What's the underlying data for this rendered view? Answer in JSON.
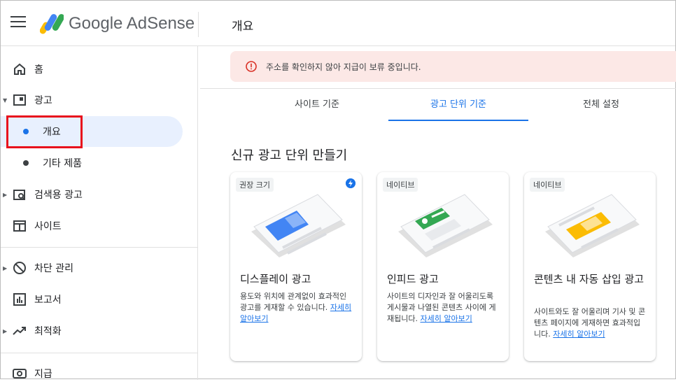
{
  "header": {
    "brand": "Google AdSense",
    "page_title": "개요"
  },
  "sidebar": {
    "items": [
      {
        "label": "홈",
        "icon": "home-icon"
      },
      {
        "label": "광고",
        "icon": "ads-icon"
      },
      {
        "label": "개요"
      },
      {
        "label": "기타 제품"
      },
      {
        "label": "검색용 광고",
        "icon": "search-ads-icon"
      },
      {
        "label": "사이트",
        "icon": "sites-icon"
      },
      {
        "label": "차단 관리",
        "icon": "block-icon"
      },
      {
        "label": "보고서",
        "icon": "reports-icon"
      },
      {
        "label": "최적화",
        "icon": "optimize-icon"
      },
      {
        "label": "지급",
        "icon": "payments-icon"
      }
    ]
  },
  "alert": {
    "text": "주소를 확인하지 않아 지급이 보류 중입니다."
  },
  "tabs": [
    {
      "label": "사이트 기준"
    },
    {
      "label": "광고 단위 기준",
      "active": true
    },
    {
      "label": "전체 설정"
    }
  ],
  "section_title": "신규 광고 단위 만들기",
  "cards": [
    {
      "chip": "권장 크기",
      "title": "디스플레이 광고",
      "desc": "용도와 위치에 관계없이 효과적인 광고를 게재할 수 있습니다.",
      "link": "자세히 알아보기"
    },
    {
      "chip": "네이티브",
      "title": "인피드 광고",
      "desc": "사이트의 디자인과 잘 어울리도록 게시물과 나열된 콘텐츠 사이에 게재됩니다.",
      "link": "자세히 알아보기"
    },
    {
      "chip": "네이티브",
      "title": "콘텐츠 내 자동 삽입 광고",
      "desc": "사이트와도 잘 어울리며 기사 및 콘텐츠 페이지에 게재하면 효과적입니다.",
      "link": "자세히 알아보기"
    }
  ],
  "colors": {
    "accent": "#1a73e8",
    "alert_bg": "#fce8e6",
    "alert_icon": "#d93025",
    "highlight": "#e8101c"
  }
}
